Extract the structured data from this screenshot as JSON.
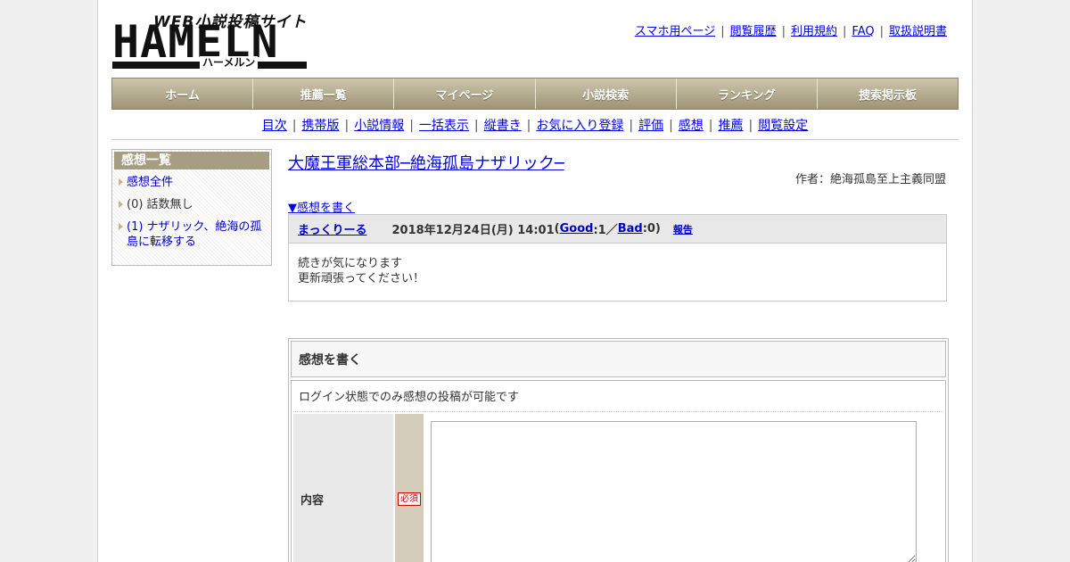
{
  "logo": {
    "tagline": "WEB小説投稿サイト",
    "wordmark": "HAMELN",
    "kana": "ハーメルン"
  },
  "top_links": [
    "スマホ用ページ",
    "閲覧履歴",
    "利用規約",
    "FAQ",
    "取扱説明書"
  ],
  "main_nav": [
    "ホーム",
    "推薦一覧",
    "マイページ",
    "小説検索",
    "ランキング",
    "捜索掲示板"
  ],
  "sub_nav": [
    "目次",
    "携帯版",
    "小説情報",
    "一括表示",
    "縦書き",
    "お気に入り登録",
    "評価",
    "感想",
    "推薦",
    "閲覧設定"
  ],
  "sidebar": {
    "title": "感想一覧",
    "items": [
      {
        "label": "感想全件",
        "link": true
      },
      {
        "label": "(0) 話数無し",
        "link": false
      },
      {
        "label": "(1) ナザリック、絶海の孤島に転移する",
        "link": true
      }
    ]
  },
  "novel": {
    "title": "大魔王軍総本部─絶海孤島ナザリック─",
    "author": "作者：絶海孤島至上主義同盟"
  },
  "write_link": "▼感想を書く",
  "review": {
    "reviewer": "まっくりーる",
    "date": "2018年12月24日(月) 14:01",
    "open": " (",
    "good_label": "Good",
    "good_count": ":1／",
    "bad_label": "Bad",
    "bad_count": ":0)",
    "report": "報告",
    "lines": [
      "続きが気になります",
      "更新頑張ってください！"
    ]
  },
  "form": {
    "heading": "感想を書く",
    "notice": "ログイン状態でのみ感想の投稿が可能です",
    "content_label": "内容",
    "required_label": "必須"
  }
}
